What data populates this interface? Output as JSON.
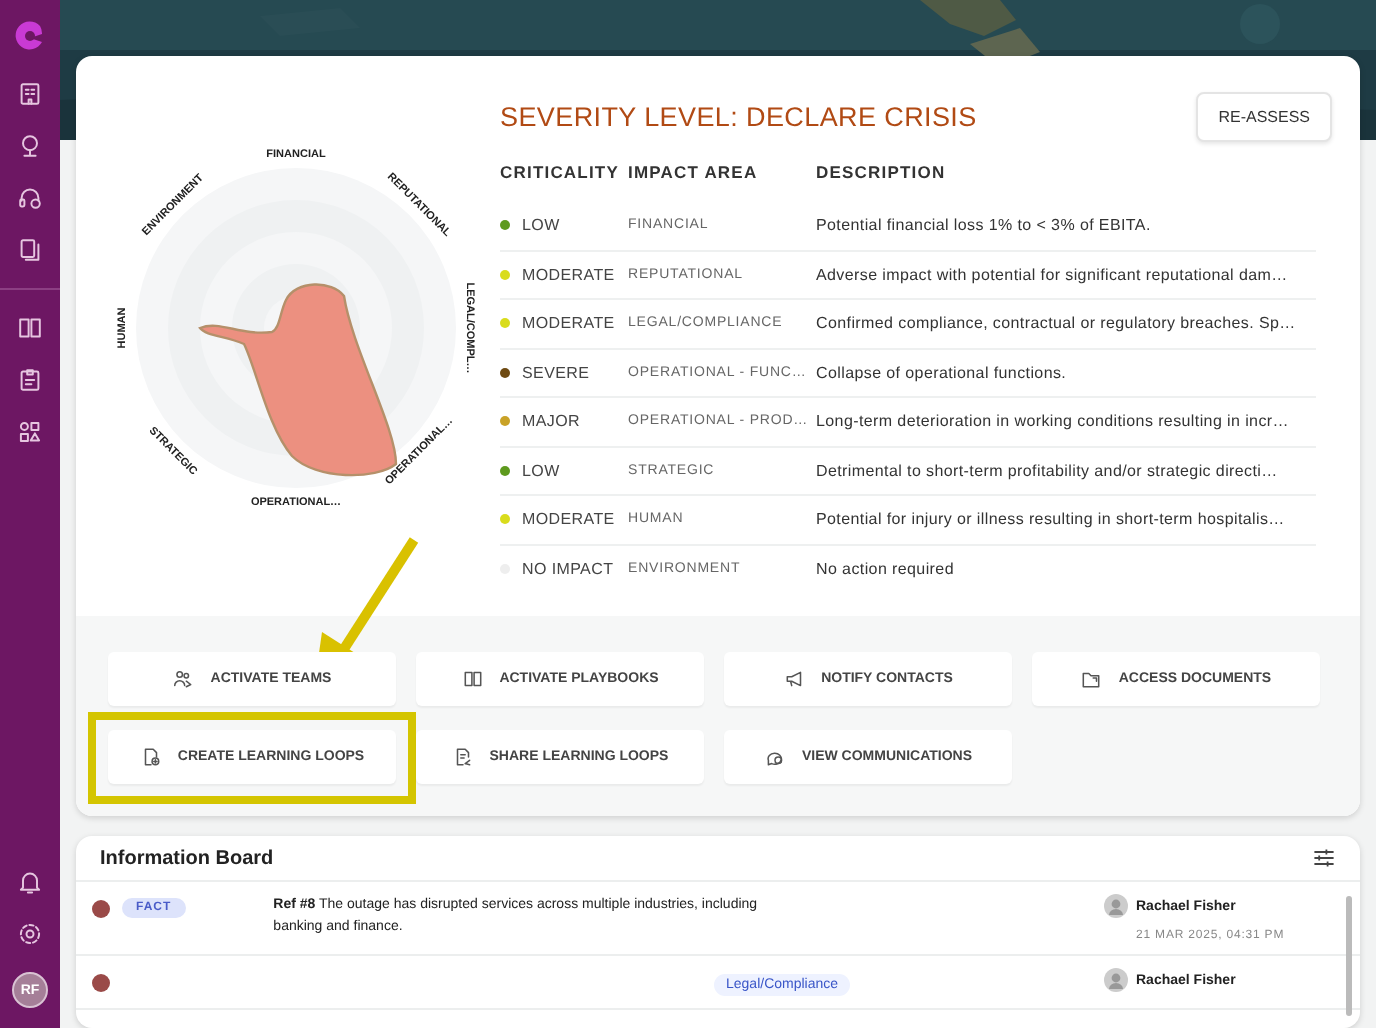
{
  "sidebar": {
    "avatar": "RF"
  },
  "severity": {
    "title": "SEVERITY LEVEL: DECLARE CRISIS",
    "reassess": "RE-ASSESS"
  },
  "radar": {
    "axes": [
      "FINANCIAL",
      "REPUTATIONAL",
      "LEGAL/COMPL…",
      "OPERATIONAL…",
      "OPERATIONAL…",
      "STRATEGIC",
      "HUMAN",
      "ENVIRONMENT"
    ]
  },
  "table": {
    "columns": [
      "CRITICALITY",
      "IMPACT AREA",
      "DESCRIPTION"
    ],
    "rows": [
      {
        "criticality": "LOW",
        "color": "#5e9a1e",
        "impact_area": "FINANCIAL",
        "description": "Potential financial loss 1% to < 3% of EBITA."
      },
      {
        "criticality": "MODERATE",
        "color": "#d9dc1c",
        "impact_area": "REPUTATIONAL",
        "description": "Adverse impact with potential for significant reputational dam…"
      },
      {
        "criticality": "MODERATE",
        "color": "#d9dc1c",
        "impact_area": "LEGAL/COMPLIANCE",
        "description": "Confirmed compliance, contractual or regulatory breaches. Sp…"
      },
      {
        "criticality": "SEVERE",
        "color": "#6e4a12",
        "impact_area": "OPERATIONAL - FUNC…",
        "description": "Collapse of operational functions."
      },
      {
        "criticality": "MAJOR",
        "color": "#c9a227",
        "impact_area": "OPERATIONAL - PROD…",
        "description": "Long-term deterioration in working conditions resulting in incr…"
      },
      {
        "criticality": "LOW",
        "color": "#5e9a1e",
        "impact_area": "STRATEGIC",
        "description": "Detrimental to short-term profitability and/or strategic directi…"
      },
      {
        "criticality": "MODERATE",
        "color": "#d9dc1c",
        "impact_area": "HUMAN",
        "description": "Potential for injury or illness resulting in short-term hospitalis…"
      },
      {
        "criticality": "NO IMPACT",
        "color": "#eeeeee",
        "impact_area": "ENVIRONMENT",
        "description": "No action required"
      }
    ]
  },
  "actions": [
    {
      "label": "ACTIVATE TEAMS",
      "highlighted": false
    },
    {
      "label": "ACTIVATE PLAYBOOKS",
      "highlighted": false
    },
    {
      "label": "NOTIFY CONTACTS",
      "highlighted": false
    },
    {
      "label": "ACCESS DOCUMENTS",
      "highlighted": false
    },
    {
      "label": "CREATE LEARNING LOOPS",
      "highlighted": true
    },
    {
      "label": "SHARE LEARNING LOOPS",
      "highlighted": false
    },
    {
      "label": "VIEW COMMUNICATIONS",
      "highlighted": false
    }
  ],
  "information_board": {
    "title": "Information Board",
    "entries": [
      {
        "color": "#9a4a48",
        "tag": "FACT",
        "ref": "Ref #8",
        "text": "The outage has disrupted services across multiple industries, including banking and finance.",
        "author": "Rachael Fisher",
        "timestamp": "21 MAR 2025, 04:31 PM"
      },
      {
        "color": "#9a4a48",
        "category": "Legal/Compliance",
        "author": "Rachael Fisher"
      }
    ]
  }
}
